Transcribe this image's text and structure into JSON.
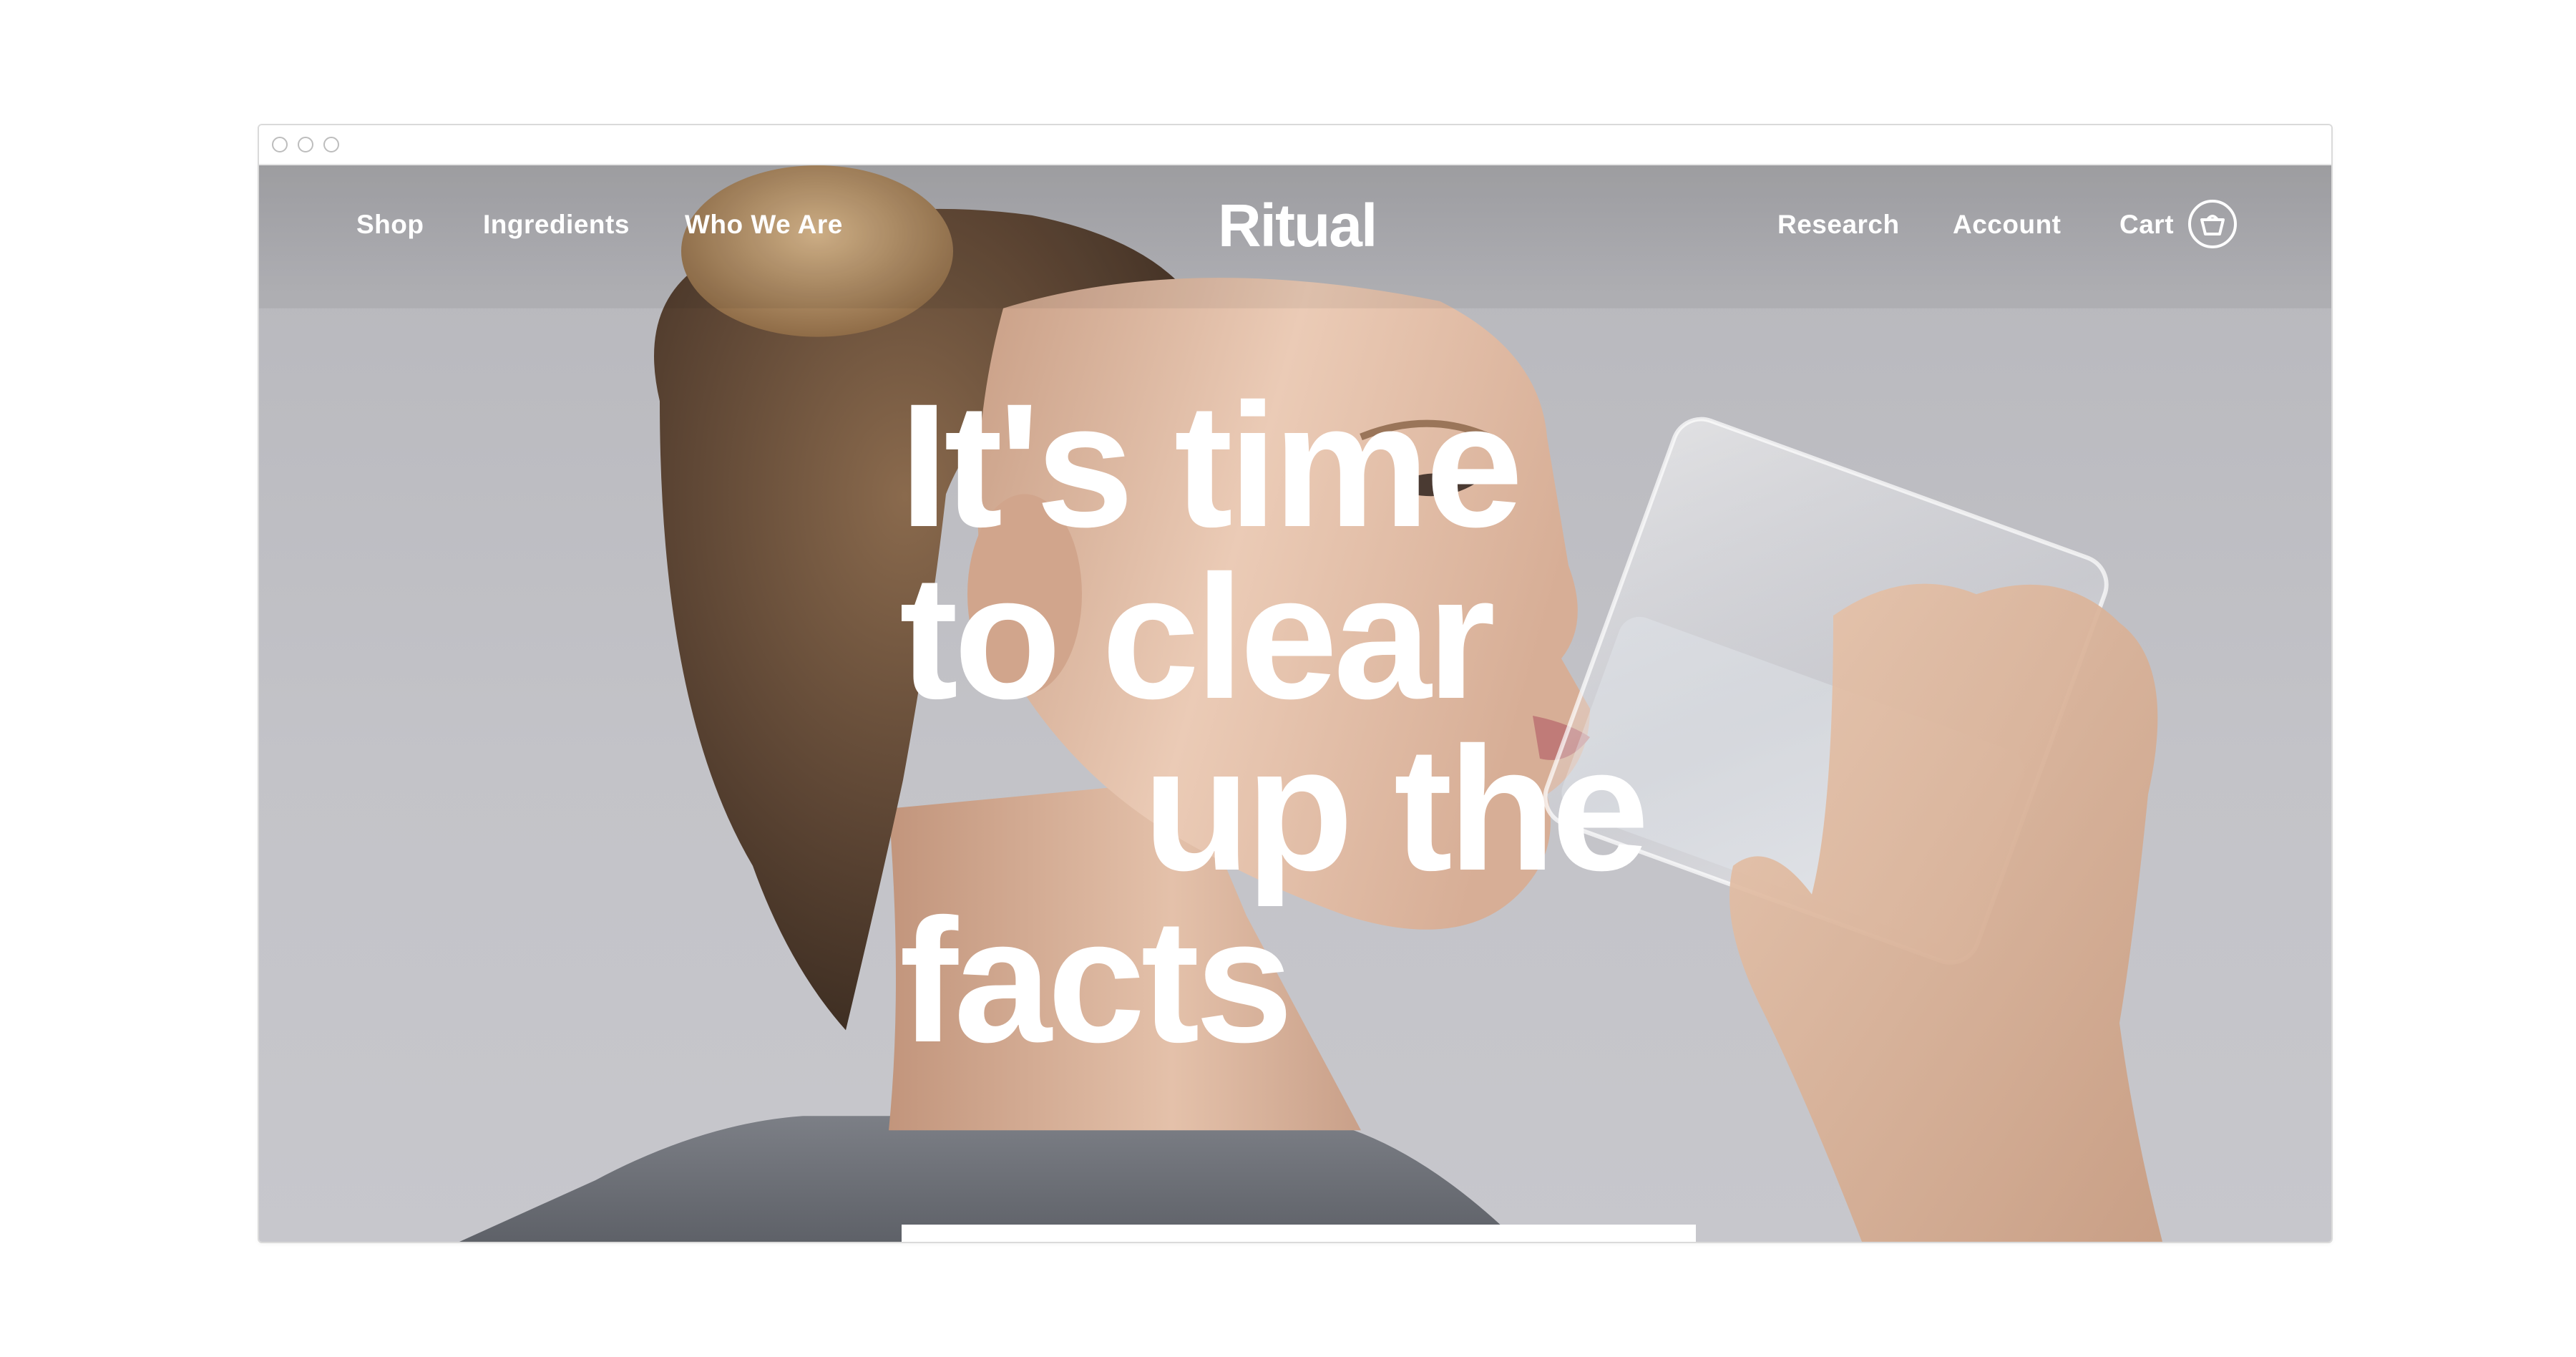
{
  "nav": {
    "left_links": [
      "Shop",
      "Ingredients",
      "Who We Are"
    ],
    "logo": "Ritual",
    "right_links": [
      "Research",
      "Account",
      "Cart"
    ],
    "cart_icon": "basket-icon"
  },
  "hero": {
    "headline_lines": [
      "It's time",
      "to clear",
      "up the",
      "facts"
    ],
    "photo": "woman drinking water from glass"
  },
  "colors": {
    "text": "#ffffff",
    "background": "#c3c3c8"
  }
}
